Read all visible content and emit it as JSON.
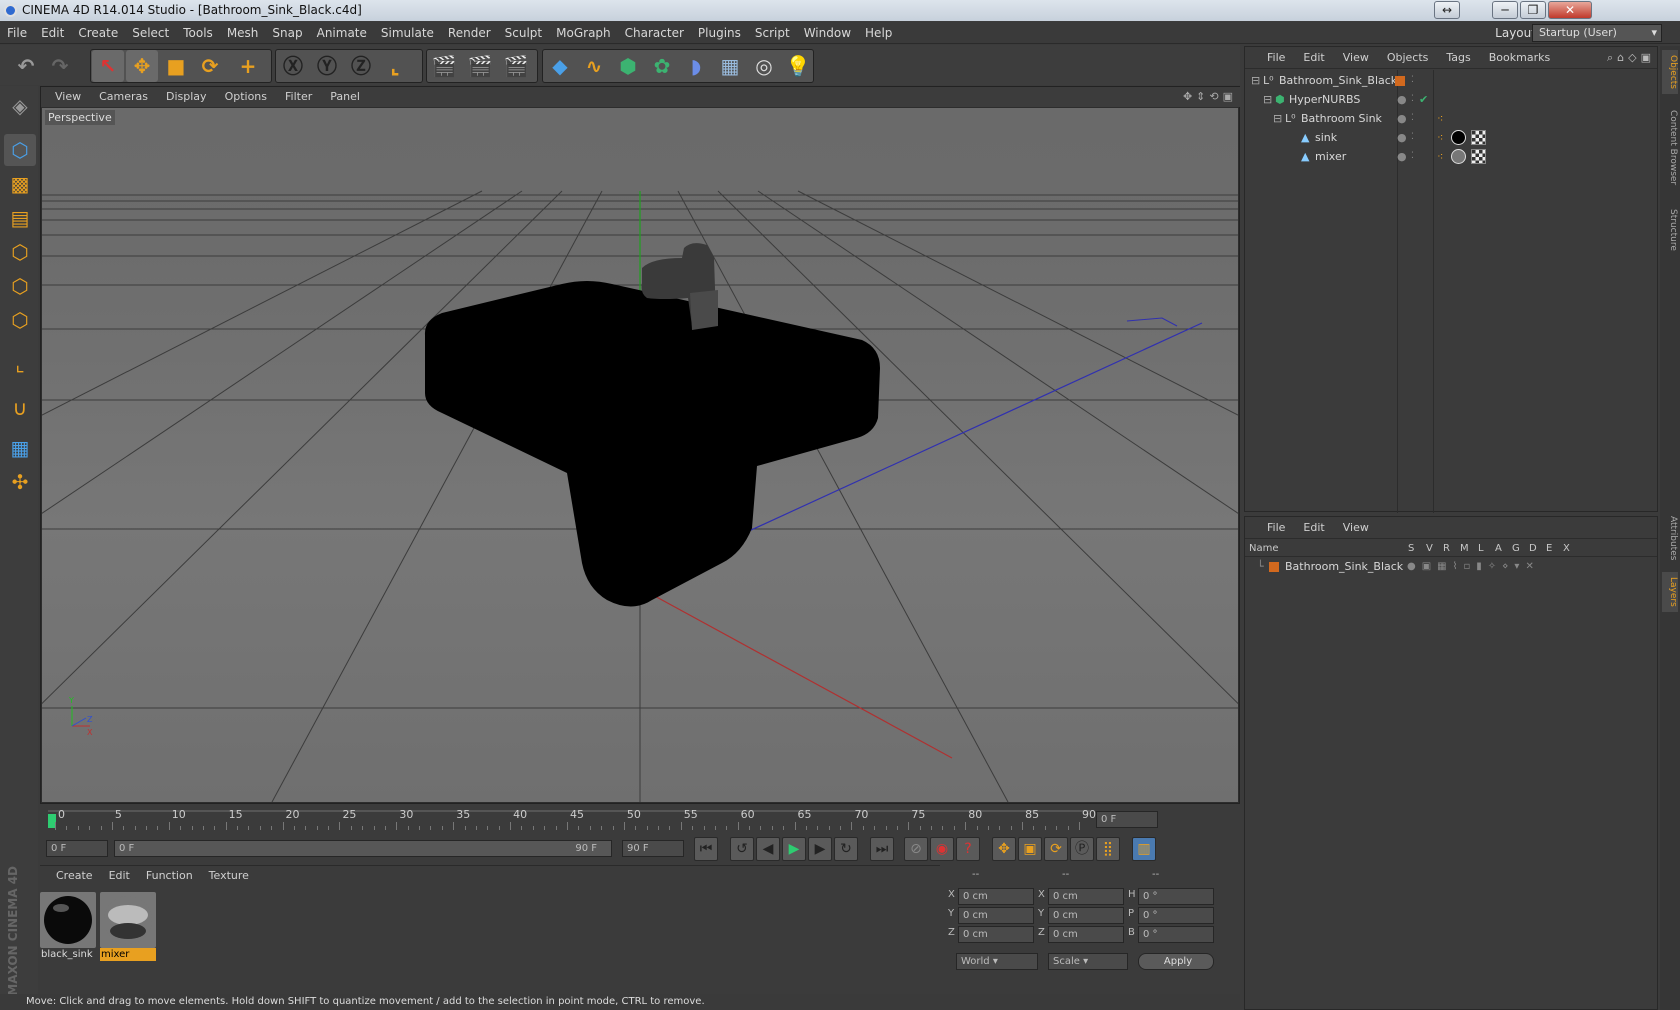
{
  "window": {
    "title": "CINEMA 4D R14.014 Studio - [Bathroom_Sink_Black.c4d]",
    "buttons": [
      "↔",
      "─",
      "❐",
      "✕"
    ]
  },
  "menu": [
    "File",
    "Edit",
    "Create",
    "Select",
    "Tools",
    "Mesh",
    "Snap",
    "Animate",
    "Simulate",
    "Render",
    "Sculpt",
    "MoGraph",
    "Character",
    "Plugins",
    "Script",
    "Window",
    "Help"
  ],
  "layout": {
    "label": "Layout:",
    "value": "Startup (User)"
  },
  "viewport": {
    "menu": [
      "View",
      "Cameras",
      "Display",
      "Options",
      "Filter",
      "Panel"
    ],
    "label": "Perspective"
  },
  "timeline": {
    "ticks": [
      "0",
      "5",
      "10",
      "15",
      "20",
      "25",
      "30",
      "35",
      "40",
      "45",
      "50",
      "55",
      "60",
      "65",
      "70",
      "75",
      "80",
      "85",
      "90"
    ],
    "current": "0 F",
    "start": "0 F",
    "range_start": "0 F",
    "range_end": "90 F",
    "end": "90 F"
  },
  "materials": {
    "menu": [
      "Create",
      "Edit",
      "Function",
      "Texture"
    ],
    "items": [
      {
        "name": "black_sink",
        "color": "#111111"
      },
      {
        "name": "mixer",
        "color": "#8a8a8a"
      }
    ]
  },
  "coords": {
    "headers": [
      "--",
      "--",
      "--"
    ],
    "rows": [
      {
        "a": "X",
        "av": "0 cm",
        "b": "X",
        "bv": "0 cm",
        "c": "H",
        "cv": "0 °"
      },
      {
        "a": "Y",
        "av": "0 cm",
        "b": "Y",
        "bv": "0 cm",
        "c": "P",
        "cv": "0 °"
      },
      {
        "a": "Z",
        "av": "0 cm",
        "b": "Z",
        "bv": "0 cm",
        "c": "B",
        "cv": "0 °"
      }
    ],
    "world": "World",
    "scale": "Scale",
    "apply": "Apply"
  },
  "status": "Move: Click and drag to move elements. Hold down SHIFT to quantize movement / add to the selection in point mode, CTRL to remove.",
  "object_manager": {
    "menu": [
      "File",
      "Edit",
      "View",
      "Objects",
      "Tags",
      "Bookmarks"
    ],
    "objects": [
      {
        "name": "Bathroom_Sink_Black"
      },
      {
        "name": "HyperNURBS"
      },
      {
        "name": "Bathroom Sink"
      },
      {
        "name": "sink"
      },
      {
        "name": "mixer"
      }
    ]
  },
  "layer_manager": {
    "menu": [
      "File",
      "Edit",
      "View"
    ],
    "columns": [
      "Name",
      "S",
      "V",
      "R",
      "M",
      "L",
      "A",
      "G",
      "D",
      "E",
      "X"
    ],
    "layers": [
      {
        "name": "Bathroom_Sink_Black"
      }
    ]
  },
  "right_tabs": [
    "Objects",
    "Content Browser",
    "Structure",
    "Attributes",
    "Layers"
  ],
  "brand": "MAXON CINEMA 4D",
  "colors": {
    "accent": "#e8a020",
    "layer": "#d2691e",
    "xaxis": "#b03030",
    "yaxis": "#20a020",
    "zaxis": "#3030b0"
  }
}
